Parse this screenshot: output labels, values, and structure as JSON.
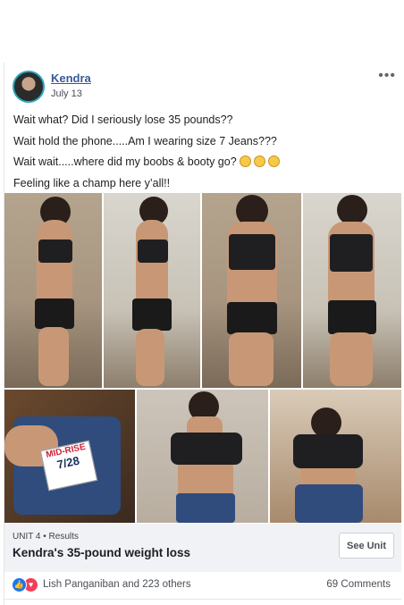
{
  "post": {
    "author": "Kendra",
    "date": "July 13",
    "lines": [
      "Wait what? Did I seriously lose 35 pounds??",
      "Wait hold the phone.....Am I wearing size 7 Jeans???",
      "Wait wait.....where did my boobs & booty go?",
      "Feeling like a champ here y’all!!"
    ],
    "emoji": [
      "laughing-tears-emoji",
      "laughing-tears-emoji",
      "laughing-tears-emoji"
    ],
    "tag_text": {
      "brand": "MID-RISE",
      "size": "7/28"
    }
  },
  "unit": {
    "label": "UNIT 4 • Results",
    "title": "Kendra's 35-pound weight loss",
    "button": "See Unit"
  },
  "reactions": {
    "names": "Lish Panganiban and 223 others",
    "comments": "69 Comments"
  },
  "colors": {
    "link": "#385898",
    "like": "#1877f2",
    "love": "#f33e58",
    "bar": "#f0f2f5"
  }
}
